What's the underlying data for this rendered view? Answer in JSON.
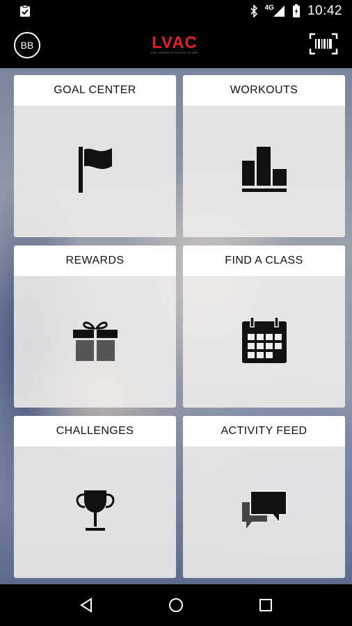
{
  "status_bar": {
    "time": "10:42",
    "network_label": "4G",
    "icons": [
      "clipboard-check-icon",
      "bluetooth-icon",
      "signal-icon",
      "battery-icon"
    ]
  },
  "header": {
    "avatar_initials": "BB",
    "logo_text": "LVAC",
    "logo_subtext": "LAS VEGAS ATHLETIC CLUBS",
    "barcode_icon": "barcode-scan-icon"
  },
  "tiles": [
    {
      "label": "GOAL CENTER",
      "icon": "flag-icon"
    },
    {
      "label": "WORKOUTS",
      "icon": "bar-chart-icon"
    },
    {
      "label": "REWARDS",
      "icon": "gift-icon"
    },
    {
      "label": "FIND A CLASS",
      "icon": "calendar-icon"
    },
    {
      "label": "CHALLENGES",
      "icon": "trophy-icon"
    },
    {
      "label": "ACTIVITY FEED",
      "icon": "chat-bubbles-icon"
    }
  ],
  "nav": {
    "back_icon": "back-triangle-icon",
    "home_icon": "home-circle-icon",
    "recents_icon": "recents-square-icon"
  }
}
